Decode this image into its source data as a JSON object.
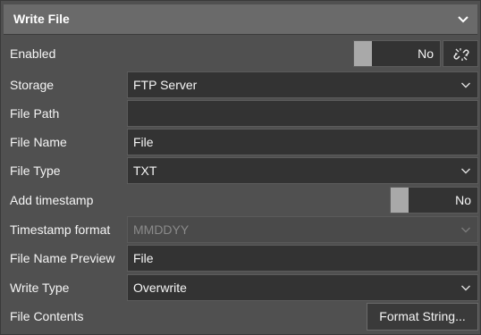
{
  "header": {
    "title": "Write File",
    "collapse_icon": "chevron-down-icon"
  },
  "rows": {
    "enabled": {
      "label": "Enabled",
      "toggle_value": "No",
      "link_icon": "unlink-icon"
    },
    "storage": {
      "label": "Storage",
      "value": "FTP Server"
    },
    "file_path": {
      "label": "File Path",
      "value": ""
    },
    "file_name": {
      "label": "File Name",
      "value": "File"
    },
    "file_type": {
      "label": "File Type",
      "value": "TXT"
    },
    "add_timestamp": {
      "label": "Add timestamp",
      "toggle_value": "No"
    },
    "timestamp_format": {
      "label": "Timestamp format",
      "value": "MMDDYY"
    },
    "file_name_preview": {
      "label": "File Name Preview",
      "value": "File"
    },
    "write_type": {
      "label": "Write Type",
      "value": "Overwrite"
    },
    "file_contents": {
      "label": "File Contents",
      "button": "Format String..."
    }
  }
}
